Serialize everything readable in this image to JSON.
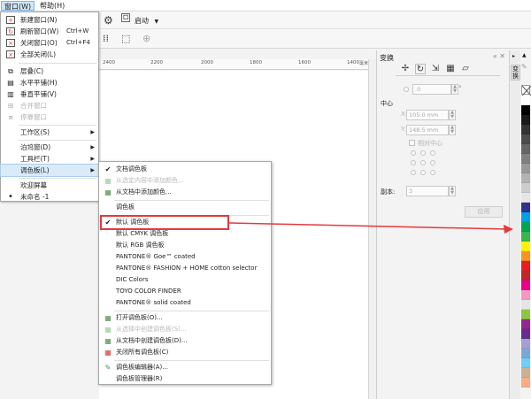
{
  "menubar": {
    "items": [
      {
        "label": "窗口(W)"
      },
      {
        "label": "帮助(H)"
      }
    ]
  },
  "toolbar": {
    "launch_label": "启动"
  },
  "ruler": {
    "labels": [
      "2400",
      "2200",
      "2000",
      "1800",
      "1600",
      "1400"
    ],
    "unit": "毫米"
  },
  "window_menu": {
    "items": [
      {
        "label": "新建窗口(N)",
        "shortcut": "",
        "icon": "new-window-icon",
        "enabled": true
      },
      {
        "label": "刷新窗口(W)",
        "shortcut": "Ctrl+W",
        "icon": "refresh-window-icon",
        "enabled": true
      },
      {
        "label": "关闭窗口(O)",
        "shortcut": "Ctrl+F4",
        "icon": "close-window-icon",
        "enabled": true
      },
      {
        "label": "全部关闭(L)",
        "shortcut": "",
        "icon": "close-all-icon",
        "enabled": true
      },
      {
        "label": "层叠(C)",
        "shortcut": "",
        "icon": "cascade-icon",
        "enabled": true
      },
      {
        "label": "水平平铺(H)",
        "shortcut": "",
        "icon": "tile-horizontal-icon",
        "enabled": true
      },
      {
        "label": "垂直平铺(V)",
        "shortcut": "",
        "icon": "tile-vertical-icon",
        "enabled": true
      },
      {
        "label": "合并窗口",
        "shortcut": "",
        "icon": "merge-windows-icon",
        "enabled": false
      },
      {
        "label": "停靠窗口",
        "shortcut": "",
        "icon": "dock-window-icon",
        "enabled": false
      },
      {
        "label": "工作区(S)",
        "submenu": true
      },
      {
        "label": "泊坞窗(D)",
        "submenu": true
      },
      {
        "label": "工具栏(T)",
        "submenu": true
      },
      {
        "label": "调色板(L)",
        "submenu": true
      },
      {
        "label": "欢迎屏幕",
        "shortcut": ""
      },
      {
        "label": "未命名 -1",
        "shortcut": "",
        "bullet": "•"
      }
    ]
  },
  "palette_menu": {
    "items": [
      {
        "label": "文档调色板",
        "icon": "check-icon",
        "enabled": true
      },
      {
        "label": "从选定内容中添加颜色...",
        "icon": "add-from-selection-icon",
        "enabled": false
      },
      {
        "label": "从文档中添加颜色...",
        "icon": "add-from-document-icon",
        "enabled": true
      },
      {
        "label": "调色板",
        "icon": "",
        "enabled": true
      },
      {
        "label": "默认 调色板",
        "icon": "check-icon",
        "enabled": true
      },
      {
        "label": "默认 CMYK 调色板",
        "icon": "",
        "enabled": true
      },
      {
        "label": "默认 RGB 调色板",
        "icon": "",
        "enabled": true
      },
      {
        "label": "PANTONE® Goe™ coated",
        "icon": "",
        "enabled": true
      },
      {
        "label": "PANTONE® FASHION + HOME cotton selector",
        "icon": "",
        "enabled": true
      },
      {
        "label": "DIC Colors",
        "icon": "",
        "enabled": true
      },
      {
        "label": "TOYO COLOR FINDER",
        "icon": "",
        "enabled": true
      },
      {
        "label": "PANTONE® solid coated",
        "icon": "",
        "enabled": true
      },
      {
        "label": "打开调色板(O)...",
        "icon": "open-palette-icon",
        "enabled": true
      },
      {
        "label": "从选择中创建调色板(S)...",
        "icon": "create-from-selection-icon",
        "enabled": false
      },
      {
        "label": "从文档中创建调色板(D)...",
        "icon": "create-from-document-icon",
        "enabled": true
      },
      {
        "label": "关闭所有调色板(C)",
        "icon": "close-all-palettes-icon",
        "enabled": true
      },
      {
        "label": "调色板编辑器(A)...",
        "icon": "palette-editor-icon",
        "enabled": true
      },
      {
        "label": "调色板管理器(R)",
        "icon": "",
        "enabled": true
      }
    ]
  },
  "docker": {
    "title": "变换",
    "angle_value": ".0",
    "center_label": "中心",
    "x_value": "105.0 mm",
    "y_value": "148.5 mm",
    "relative_center": "相对中心",
    "copies_label": "副本:",
    "copies_value": "3",
    "apply_label": "应用"
  },
  "docker_tabs": {
    "active_tab": "变换"
  },
  "palette_colors": [
    "#ffffff",
    "#000000",
    "#1a1a1a",
    "#333333",
    "#4d4d4d",
    "#666666",
    "#808080",
    "#999999",
    "#b3b3b3",
    "#cccccc",
    "#e6e6e6",
    "#2e3192",
    "#00a0e9",
    "#00a651",
    "#39b54a",
    "#fff200",
    "#f7941d",
    "#ed1c24",
    "#c1272d",
    "#ec008c",
    "#f49ac1",
    "#e5e5e5",
    "#8dc63f",
    "#92278f",
    "#662d91",
    "#a3a1d0",
    "#7da7d9",
    "#6dcff6",
    "#c7b299",
    "#f9ad81"
  ]
}
